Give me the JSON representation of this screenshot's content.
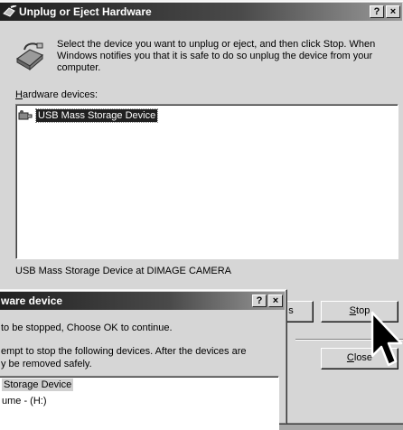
{
  "main_window": {
    "title": "Unplug or Eject Hardware",
    "help_button": "?",
    "close_button": "×",
    "instructions": "Select the device you want to unplug or eject, and then click Stop. When Windows notifies you that it is safe to do so unplug the device from your computer.",
    "hardware_label_first": "H",
    "hardware_label_rest": "ardware devices:",
    "devices": [
      "USB Mass Storage Device"
    ],
    "selected_device_description": "USB Mass Storage Device at DIMAGE CAMERA",
    "properties_button_fragment": "s",
    "stop_button_first": "S",
    "stop_button_rest": "top",
    "close_first": "C",
    "close_rest": "lose"
  },
  "dialog": {
    "title_fragment": "ware device",
    "help_button": "?",
    "close_button": "×",
    "line1": "to be stopped, Choose OK to continue.",
    "line2": "empt to stop the following devices. After the devices are",
    "line3": "y be removed safely.",
    "list_items": [
      "Storage Device",
      "ume - (H:)"
    ]
  },
  "colors": {
    "desktop": "#a8a8a8",
    "window_face": "#d6d6d6",
    "selection": "#202020"
  },
  "icons": [
    "eject-hardware-icon",
    "usb-device-icon",
    "mouse-pointer-icon"
  ]
}
